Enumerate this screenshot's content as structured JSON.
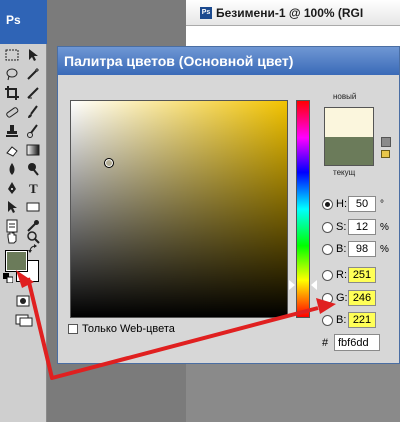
{
  "toolbox": {
    "logo": "Ps",
    "tools": [
      "marquee",
      "lasso",
      "magic-wand",
      "crop",
      "slice",
      "healing-brush",
      "brush",
      "clone-stamp",
      "history-brush",
      "eraser",
      "gradient",
      "blur",
      "dodge",
      "pen",
      "type",
      "path-selection",
      "shape",
      "notes",
      "eyedropper",
      "hand",
      "zoom"
    ]
  },
  "document": {
    "ps_icon": "Ps",
    "title": "Безимени-1 @ 100% (RGI"
  },
  "dialog": {
    "title": "Палитра цветов (Основной цвет)",
    "new_label": "новый",
    "current_label": "текущ",
    "new_color": "#fbf6dd",
    "current_color": "#6b7b5a",
    "web_only_label": "Только Web-цвета",
    "fields": [
      {
        "name": "h",
        "label": "H:",
        "value": "50",
        "unit": "°",
        "selected": true,
        "highlighted": false
      },
      {
        "name": "s",
        "label": "S:",
        "value": "12",
        "unit": "%",
        "selected": false,
        "highlighted": false
      },
      {
        "name": "b",
        "label": "B:",
        "value": "98",
        "unit": "%",
        "selected": false,
        "highlighted": false
      },
      {
        "name": "r",
        "label": "R:",
        "value": "251",
        "unit": "",
        "selected": false,
        "highlighted": true
      },
      {
        "name": "g",
        "label": "G:",
        "value": "246",
        "unit": "",
        "selected": false,
        "highlighted": true
      },
      {
        "name": "bl",
        "label": "B:",
        "value": "221",
        "unit": "",
        "selected": false,
        "highlighted": true
      }
    ],
    "hex_label": "#",
    "hex_value": "fbf6dd"
  },
  "colors": {
    "foreground": "#6b7b5a",
    "background": "#ffffff",
    "arrow": "#e02020",
    "highlight": "#ffff57"
  }
}
